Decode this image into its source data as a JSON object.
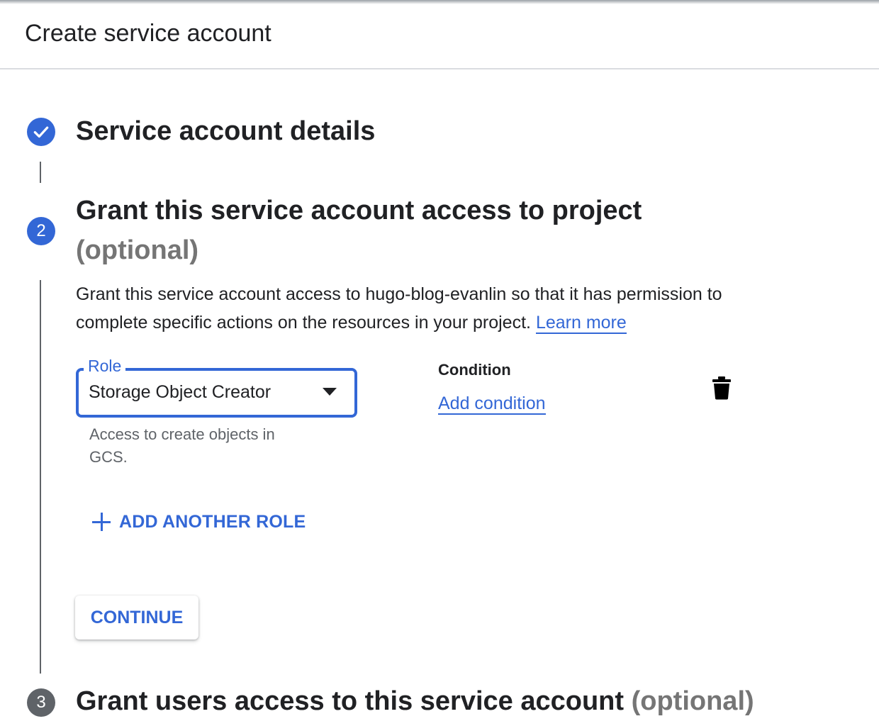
{
  "header": {
    "title": "Create service account"
  },
  "steps": [
    {
      "number": "",
      "title": "Service account details",
      "state": "completed"
    },
    {
      "number": "2",
      "title": "Grant this service account access to project",
      "optional": "(optional)",
      "state": "active"
    },
    {
      "number": "3",
      "title": "Grant users access to this service account",
      "optional": "(optional)",
      "state": "pending"
    }
  ],
  "step2": {
    "description": "Grant this service account access to hugo-blog-evanlin so that it has permission to complete specific actions on the resources in your project.",
    "learn_more": "Learn more",
    "role": {
      "label": "Role",
      "value": "Storage Object Creator",
      "help": "Access to create objects in GCS."
    },
    "condition": {
      "label": "Condition",
      "add_label": "Add condition"
    },
    "add_role_label": "ADD ANOTHER ROLE",
    "continue_label": "CONTINUE"
  },
  "icons": {
    "check": "check-icon",
    "delete": "trash-icon",
    "dropdown": "caret-down-icon",
    "add": "plus-icon"
  },
  "colors": {
    "accent": "#3367d6",
    "text": "#202124",
    "muted": "#757575",
    "pending_step": "#5f6368"
  }
}
